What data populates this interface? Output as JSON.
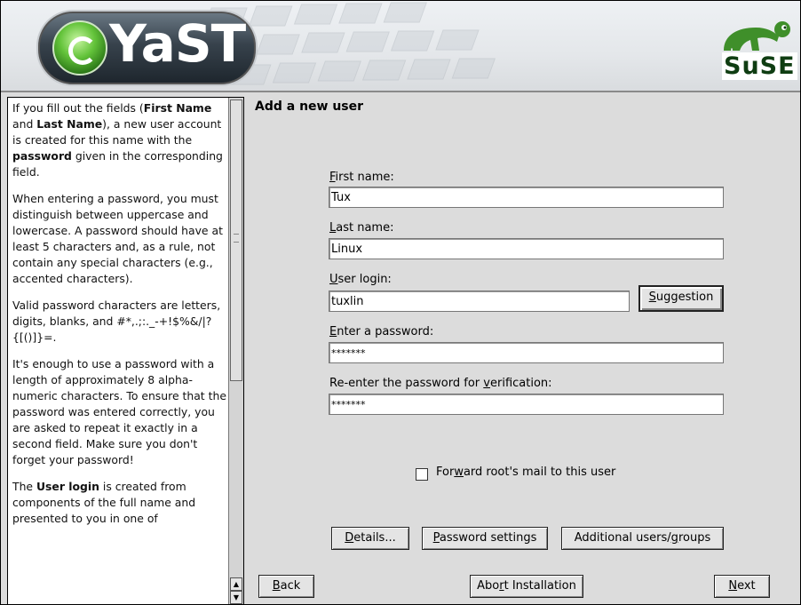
{
  "banner": {
    "app_name": "YaST",
    "vendor": "SuSE"
  },
  "help": {
    "paragraphs": [
      [
        {
          "t": "If you fill out the fields ("
        },
        {
          "t": "First Name",
          "b": true
        },
        {
          "t": " and "
        },
        {
          "t": "Last Name",
          "b": true
        },
        {
          "t": "), a new user account is created for this name with the "
        },
        {
          "t": "password",
          "b": true
        },
        {
          "t": " given in the corresponding field."
        }
      ],
      [
        {
          "t": "When entering a password, you must distinguish between uppercase and lowercase. A password should have at least 5 characters and, as a rule, not contain any special characters (e.g., accented characters)."
        }
      ],
      [
        {
          "t": "Valid password characters are letters, digits, blanks, and #*,.;:._-+!$%&/|?{[()]}=."
        }
      ],
      [
        {
          "t": "It's enough to use a password with a length of approximately 8 alpha-numeric characters. To ensure that the password was entered correctly, you are asked to repeat it exactly in a second field. Make sure you don't forget your password!"
        }
      ],
      [
        {
          "t": "The "
        },
        {
          "t": "User login",
          "b": true
        },
        {
          "t": " is created from components of the full name and presented to you in one of"
        }
      ]
    ]
  },
  "form": {
    "title": "Add a new user",
    "first_name": {
      "label_key": "F",
      "label_rest": "irst name:",
      "value": "Tux"
    },
    "last_name": {
      "label_key": "L",
      "label_rest": "ast name:",
      "value": "Linux"
    },
    "user_login": {
      "label_key": "U",
      "label_rest": "ser login:",
      "value": "tuxlin"
    },
    "suggestion_button": {
      "key": "S",
      "rest": "uggestion"
    },
    "password": {
      "label_key": "E",
      "label_rest": "nter a password:",
      "value": "*******"
    },
    "password_verify": {
      "label_pre": "Re-enter the password for ",
      "label_key": "v",
      "label_post": "erification:",
      "value": "*******"
    },
    "forward_mail": {
      "pre": "For",
      "key": "w",
      "post": "ard root's mail to this user",
      "checked": false
    },
    "details_button": {
      "key": "D",
      "rest": "etails..."
    },
    "password_settings_button": {
      "key": "P",
      "rest": "assword settings"
    },
    "additional_button": {
      "pre": "Additional users/",
      "key": "g",
      "post": "roups"
    }
  },
  "nav": {
    "back": {
      "key": "B",
      "rest": "ack"
    },
    "abort": {
      "pre": "Abo",
      "key": "r",
      "post": "t Installation"
    },
    "next": {
      "key": "N",
      "rest": "ext"
    }
  }
}
